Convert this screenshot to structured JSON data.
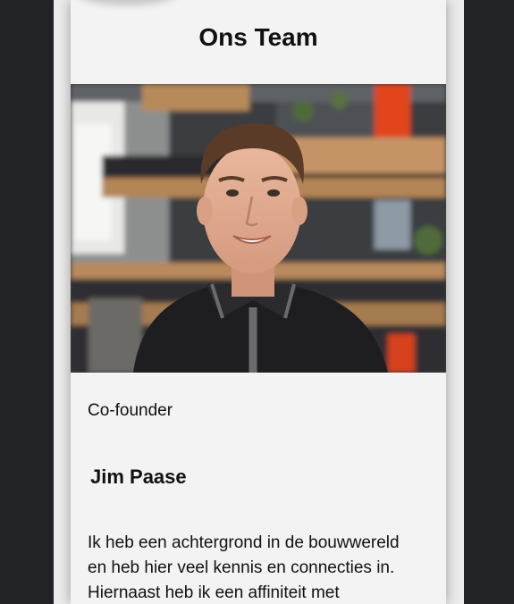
{
  "team": {
    "title": "Ons Team",
    "member": {
      "role": "Co-founder",
      "name": "Jim Paase",
      "bio": "Ik heb een achtergrond in de bouwwereld en heb hier veel kennis en connecties in. Hiernaast heb ik een affiniteit met"
    }
  },
  "colors": {
    "page_background": "#222326",
    "card_background": "#f3f3f3",
    "text": "#111111"
  }
}
